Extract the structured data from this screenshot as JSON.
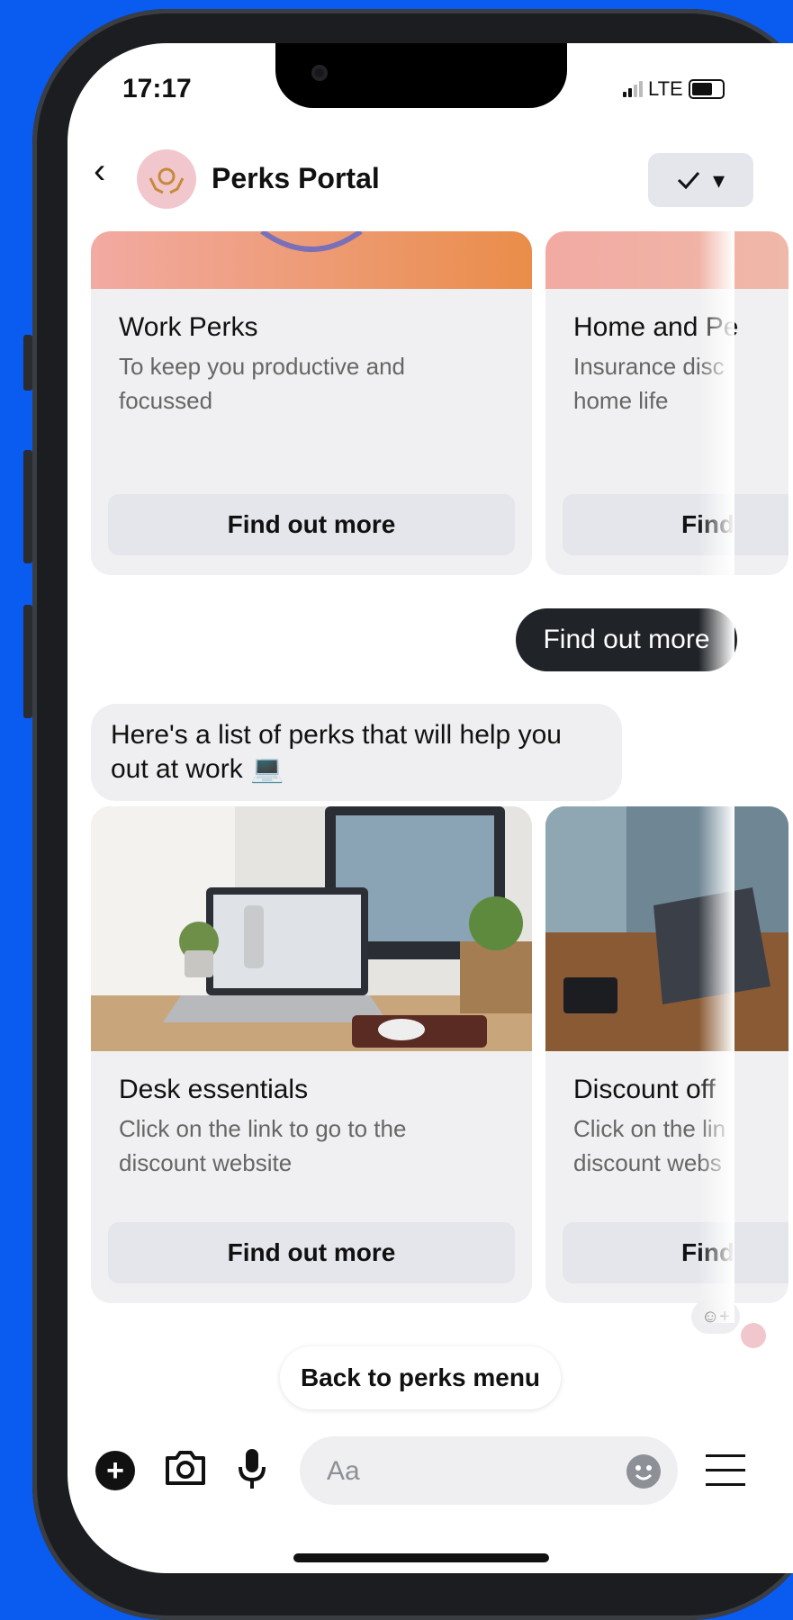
{
  "status_bar": {
    "time": "17:17",
    "network": "LTE"
  },
  "header": {
    "back_glyph": "‹",
    "title": "Perks Portal",
    "action_icon": "check-icon",
    "action_caret": "▾"
  },
  "top_cards": [
    {
      "title": "Work Perks",
      "subtitle": "To keep you productive and focussed",
      "button": "Find out more"
    },
    {
      "title": "Home and Pe",
      "subtitle": "Insurance disc home life",
      "button": "Find"
    }
  ],
  "outgoing_message": "Find out more",
  "incoming_message": "Here's a list of perks that will help you out at work 💻",
  "bottom_cards": [
    {
      "title": "Desk essentials",
      "subtitle": "Click on the link to go to the discount website",
      "button": "Find out more"
    },
    {
      "title": "Discount off",
      "subtitle": "Click on the lin discount webs",
      "button": "Find"
    }
  ],
  "react_button": "☺+",
  "back_to_menu": "Back to perks menu",
  "composer": {
    "placeholder": "Aa",
    "icons": [
      "plus-circle-icon",
      "camera-icon",
      "microphone-icon",
      "emoji-icon",
      "menu-icon"
    ]
  },
  "colors": {
    "background": "#0a5bf0",
    "bubble_out": "#202428",
    "bubble_in": "#efeff2",
    "card_bg": "#f0f0f2"
  }
}
